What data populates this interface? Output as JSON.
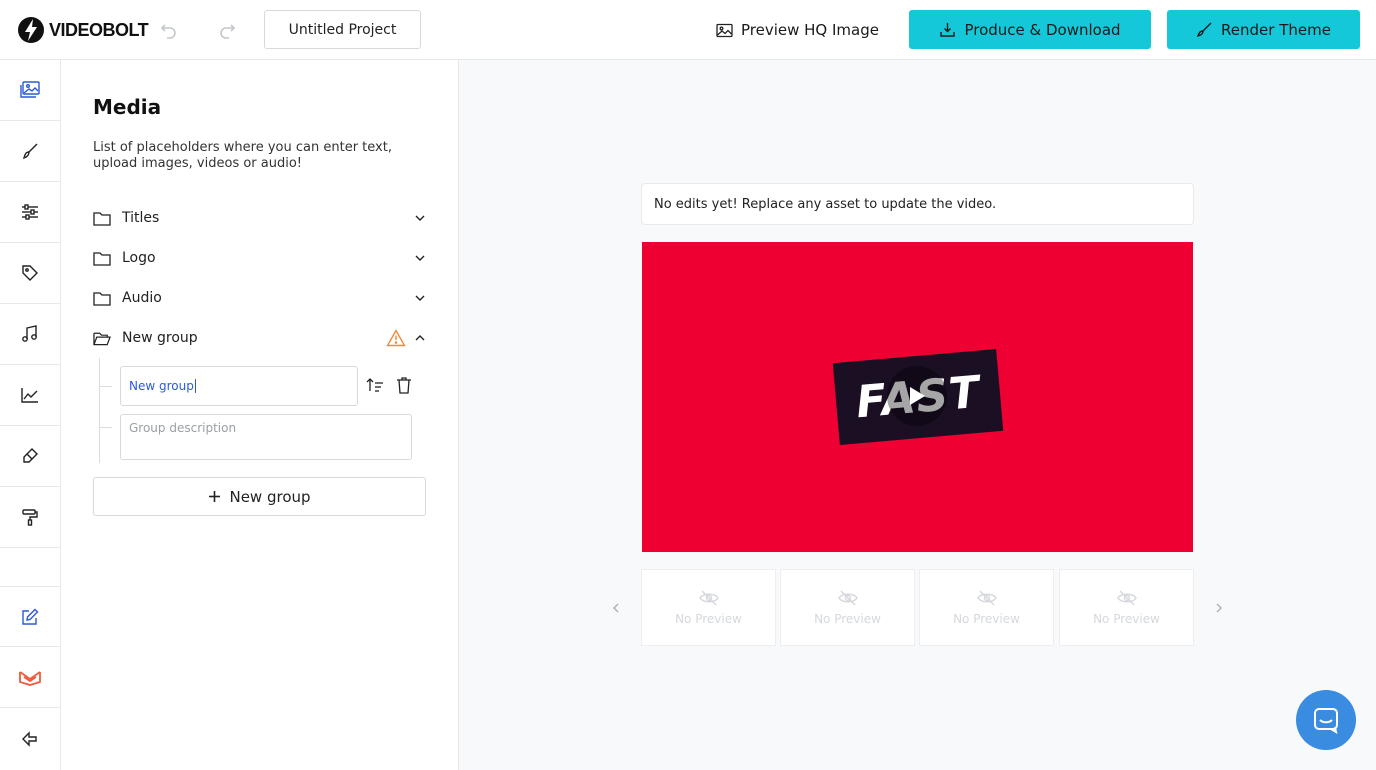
{
  "header": {
    "logo_text": "VIDEOBOLT",
    "project_name": "Untitled Project",
    "preview_hq_label": "Preview HQ Image",
    "produce_label": "Produce & Download",
    "render_label": "Render Theme",
    "accent_color": "#15c8d9"
  },
  "rail": {
    "items": [
      {
        "icon": "media-icon"
      },
      {
        "icon": "brush-icon"
      },
      {
        "icon": "sliders-icon"
      },
      {
        "icon": "tag-icon"
      },
      {
        "icon": "music-icon"
      },
      {
        "icon": "chart-icon"
      },
      {
        "icon": "eraser-icon"
      },
      {
        "icon": "paint-roller-icon"
      },
      {
        "icon": "edit-icon"
      },
      {
        "icon": "brand-logo-icon"
      },
      {
        "icon": "exit-icon"
      }
    ]
  },
  "panel": {
    "title": "Media",
    "description": "List of placeholders where you can enter text, upload images, videos or audio!",
    "groups": [
      {
        "label": "Titles"
      },
      {
        "label": "Logo"
      },
      {
        "label": "Audio"
      },
      {
        "label": "New group"
      }
    ],
    "edit": {
      "name_value": "New group",
      "description_placeholder": "Group description"
    },
    "new_group_label": "New group"
  },
  "preview": {
    "notice": "No edits yet! Replace any asset to update the video.",
    "video_text": "FAST",
    "video_bg": "#ef0033",
    "thumbnails": [
      {
        "label": "No Preview"
      },
      {
        "label": "No Preview"
      },
      {
        "label": "No Preview"
      },
      {
        "label": "No Preview"
      }
    ]
  }
}
